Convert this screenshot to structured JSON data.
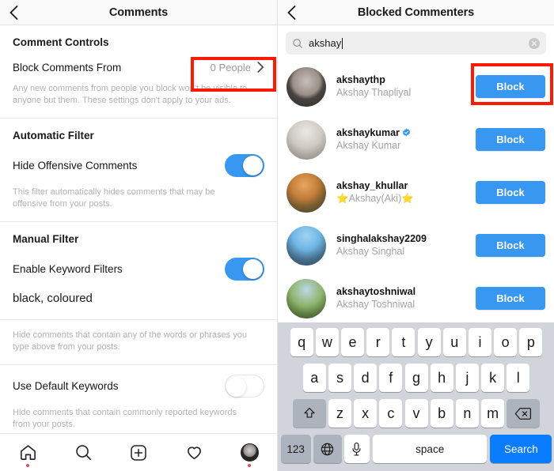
{
  "left_panel": {
    "nav": {
      "title": "Comments",
      "back_icon": "back-chevron-icon"
    },
    "sections": [
      {
        "title": "Comment Controls",
        "row_label": "Block Comments From",
        "row_value": "0 People",
        "helper": "Any new comments from people you block won't be visible to anyone but them. These settings don't apply to your ads."
      },
      {
        "title": "Automatic Filter",
        "row_label": "Hide Offensive Comments",
        "toggle_state": "on",
        "helper": "This filter automatically hides comments that may be offensive from your posts."
      },
      {
        "title": "Manual Filter",
        "row_label": "Enable Keyword Filters",
        "toggle_state": "on",
        "keywords_value": "black, coloured",
        "helper": "Hide comments that contain any of the words or phrases you type above from your posts."
      },
      {
        "row_label": "Use Default Keywords",
        "toggle_state": "off",
        "helper": "Hide comments that contain commonly reported keywords from your posts."
      }
    ],
    "tabbar": [
      {
        "name": "home-icon",
        "badge": true
      },
      {
        "name": "search-icon",
        "badge": false
      },
      {
        "name": "add-post-icon",
        "badge": false
      },
      {
        "name": "activity-heart-icon",
        "badge": false
      },
      {
        "name": "profile-avatar-icon",
        "badge": true
      }
    ]
  },
  "right_panel": {
    "nav": {
      "title": "Blocked Commenters",
      "back_icon": "back-chevron-icon"
    },
    "search": {
      "value": "akshay",
      "placeholder": "Search",
      "icon": "search-icon",
      "clear_icon": "clear-circle-icon"
    },
    "users": [
      {
        "username": "akshaythp",
        "fullname": "Akshay Thapliyal",
        "verified": false,
        "action": "Block"
      },
      {
        "username": "akshaykumar",
        "fullname": "Akshay Kumar",
        "verified": true,
        "action": "Block"
      },
      {
        "username": "akshay_khullar",
        "fullname": "⭐Akshay(Aki)⭐",
        "verified": false,
        "action": "Block"
      },
      {
        "username": "singhalakshay2209",
        "fullname": "Akshay Singhal",
        "verified": false,
        "action": "Block"
      },
      {
        "username": "akshaytoshniwal",
        "fullname": "Akshay Toshniwal",
        "verified": false,
        "action": "Block"
      }
    ],
    "keyboard": {
      "row1": [
        "q",
        "w",
        "e",
        "r",
        "t",
        "y",
        "u",
        "i",
        "o",
        "p"
      ],
      "row2": [
        "a",
        "s",
        "d",
        "f",
        "g",
        "h",
        "j",
        "k",
        "l"
      ],
      "row3": [
        "z",
        "x",
        "c",
        "v",
        "b",
        "n",
        "m"
      ],
      "shift_label": "shift-arrow-icon",
      "backspace_label": "backspace-icon",
      "numbers_label": "123",
      "globe_label": "globe-icon",
      "mic_label": "microphone-icon",
      "space_label": "space",
      "search_label": "Search"
    }
  },
  "annotations": {
    "highlight_color": "#fb1b05",
    "accent_blue": "#3897f0",
    "keyboard_blue": "#0a7cff"
  }
}
